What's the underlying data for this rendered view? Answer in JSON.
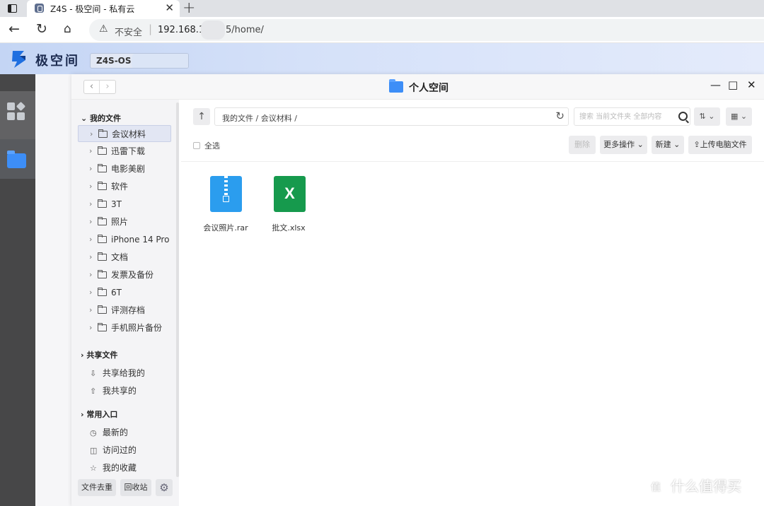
{
  "browser": {
    "tab_title": "Z4S - 极空间 - 私有云",
    "tab_close": "✕",
    "new_tab": "+",
    "insecure_label": "不安全",
    "separator": "|",
    "url_part1": "192.168.1",
    "url_part2": "5/home/"
  },
  "app": {
    "brand": "极空间",
    "device_name": "Z4S-OS"
  },
  "window": {
    "title": "个人空间",
    "nav_back": "‹",
    "nav_forward": "›",
    "min": "—",
    "max": "□",
    "close": "✕"
  },
  "sidebar": {
    "my_files": {
      "label": "我的文件",
      "items": [
        "会议材料",
        "迅雷下载",
        "电影美剧",
        "软件",
        "3T",
        "照片",
        "iPhone 14 Pro",
        "文档",
        "发票及备份",
        "6T",
        "评测存档",
        "手机照片备份"
      ]
    },
    "shared": {
      "label": "共享文件",
      "items": [
        "共享给我的",
        "我共享的"
      ]
    },
    "shortcuts": {
      "label": "常用入口",
      "items": [
        "最新的",
        "访问过的",
        "我的收藏"
      ]
    },
    "buttons": {
      "dedupe": "文件去重",
      "recycle": "回收站"
    }
  },
  "main": {
    "path": "我的文件 / 会议材料 /",
    "search_placeholder": "搜索 当前文件夹 全部内容",
    "select_all": "全选",
    "actions": {
      "delete": "删除",
      "more": "更多操作",
      "new": "新建",
      "upload": "上传电脑文件"
    },
    "files": [
      {
        "name": "会议照片.rar",
        "icon": "zip-archive-icon"
      },
      {
        "name": "批文.xlsx",
        "icon": "excel-icon",
        "glyph": "X"
      }
    ]
  },
  "watermark": {
    "badge": "值",
    "text": "什么值得买"
  }
}
